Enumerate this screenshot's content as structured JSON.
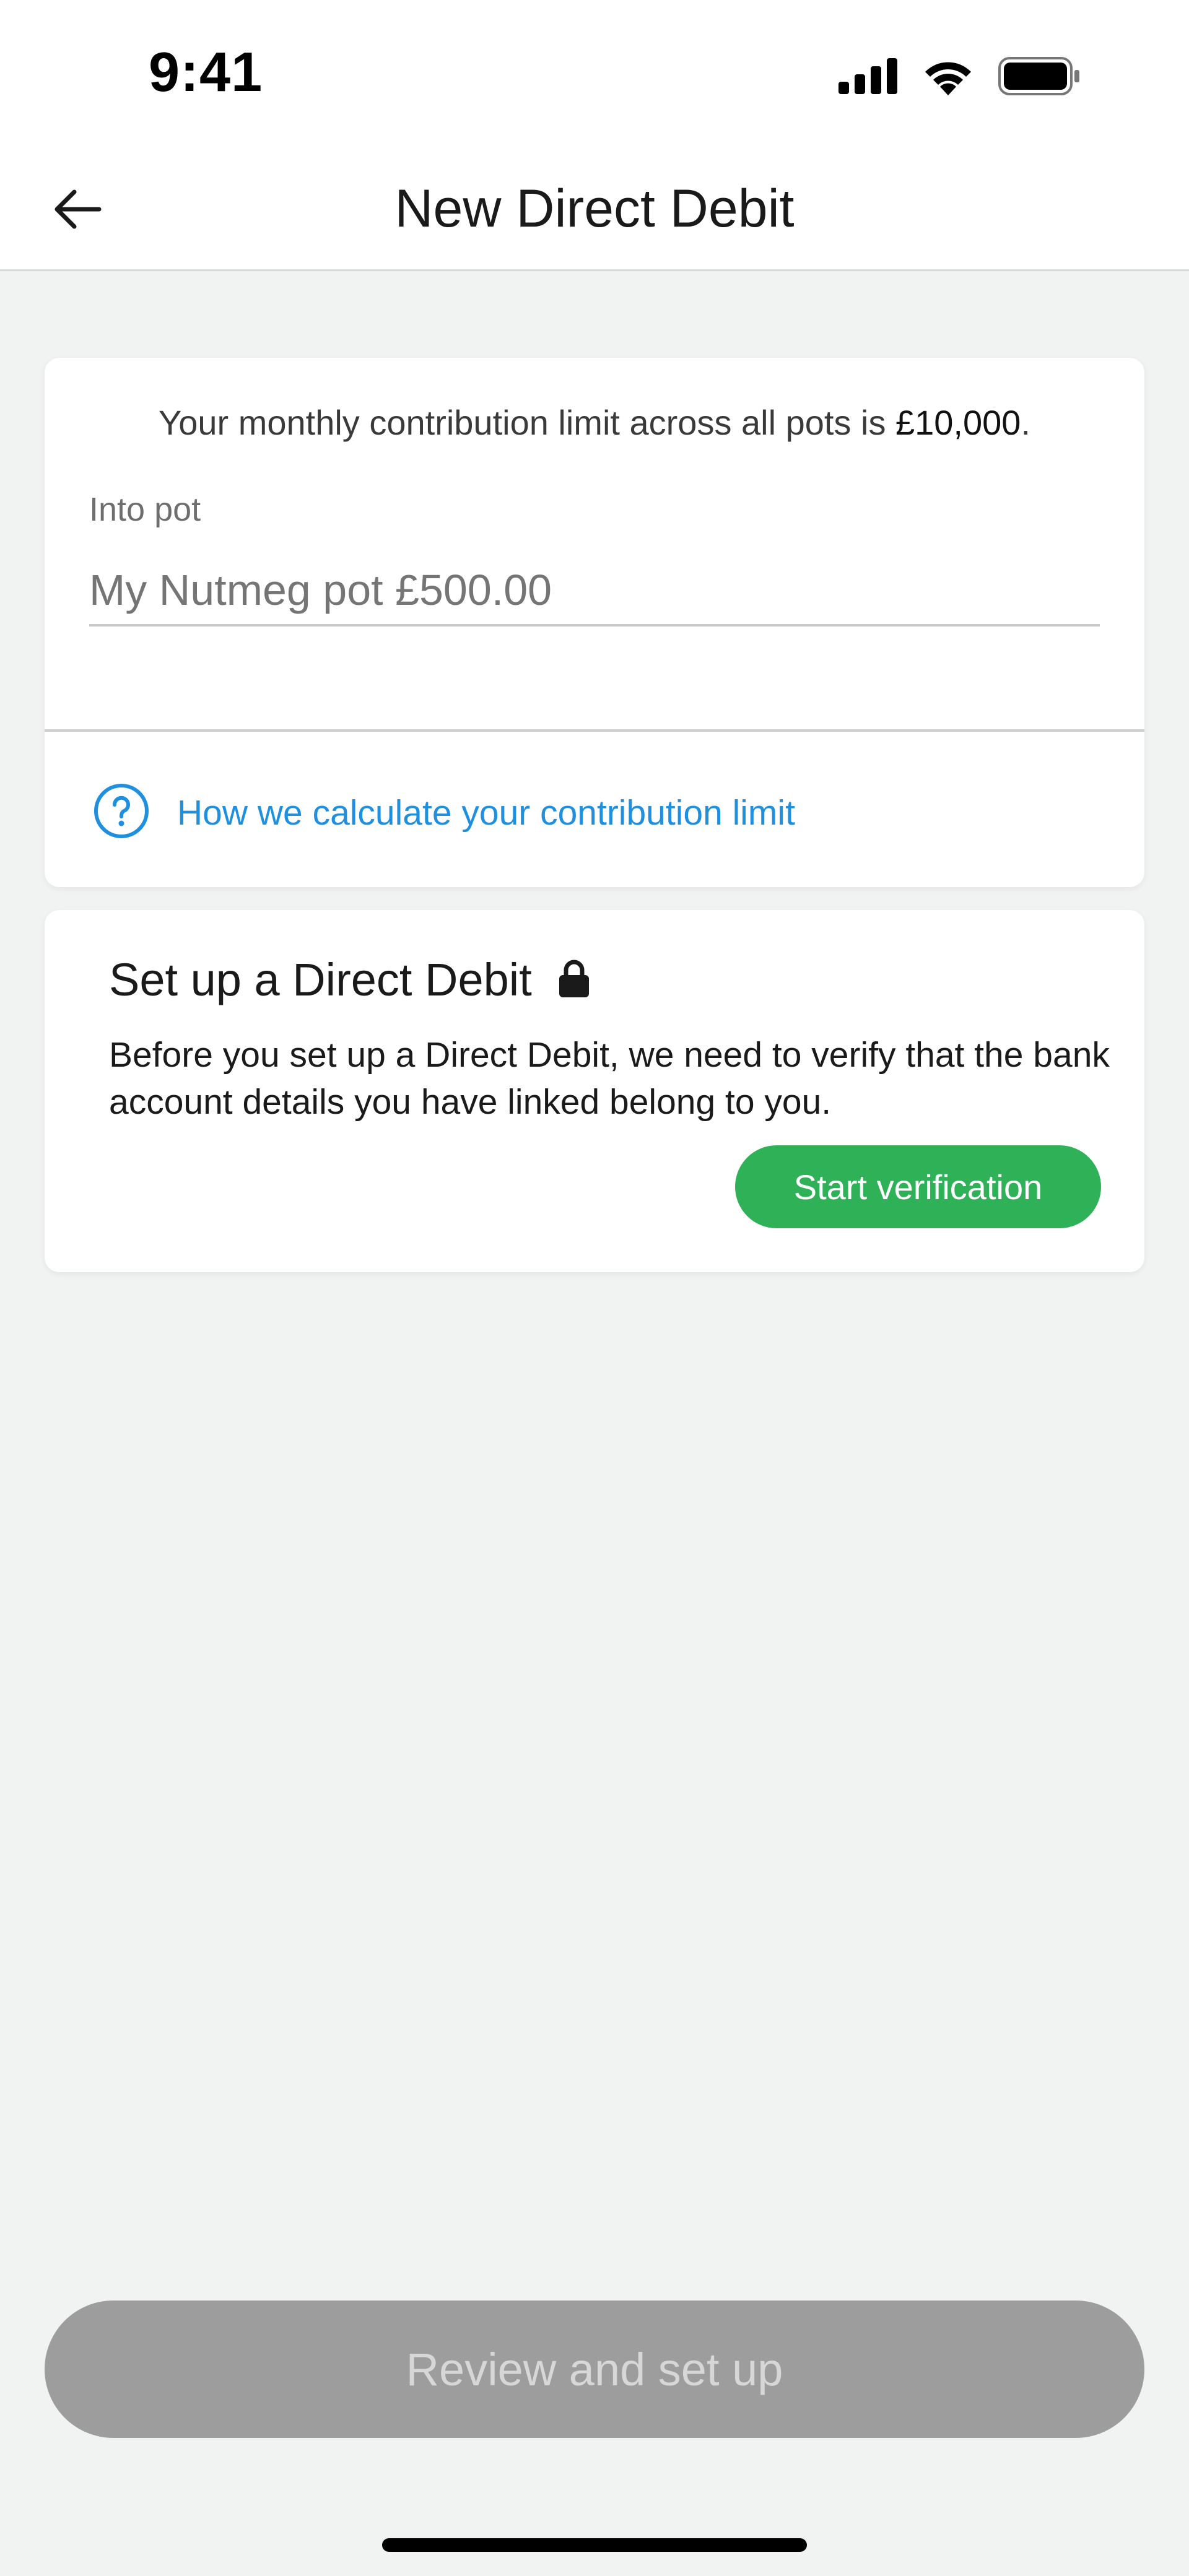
{
  "status_bar": {
    "time": "9:41",
    "icons": [
      "cellular-signal-icon",
      "wifi-icon",
      "battery-icon"
    ]
  },
  "nav": {
    "title": "New Direct Debit",
    "back_icon": "arrow-left-icon"
  },
  "limit_card": {
    "limit_text_prefix": "Your monthly contribution limit across all pots is ",
    "limit_amount": "£10,000",
    "limit_text_suffix": ".",
    "field_label": "Into pot",
    "pot_placeholder": "My Nutmeg pot £500.00",
    "help_icon": "question-circle-icon",
    "help_link": "How we calculate your contribution limit"
  },
  "direct_debit_card": {
    "title": "Set up a Direct Debit",
    "lock_icon": "lock-icon",
    "body": "Before you set up a Direct Debit, we need to verify that the bank account details you have linked belong to you.",
    "button_label": "Start verification"
  },
  "footer": {
    "review_button_label": "Review and set up",
    "review_button_enabled": false
  },
  "colors": {
    "background": "#F1F2F2",
    "accent_blue": "#1F8FE0",
    "accent_green": "#2FB157",
    "disabled_button": "#9D9D9D"
  }
}
